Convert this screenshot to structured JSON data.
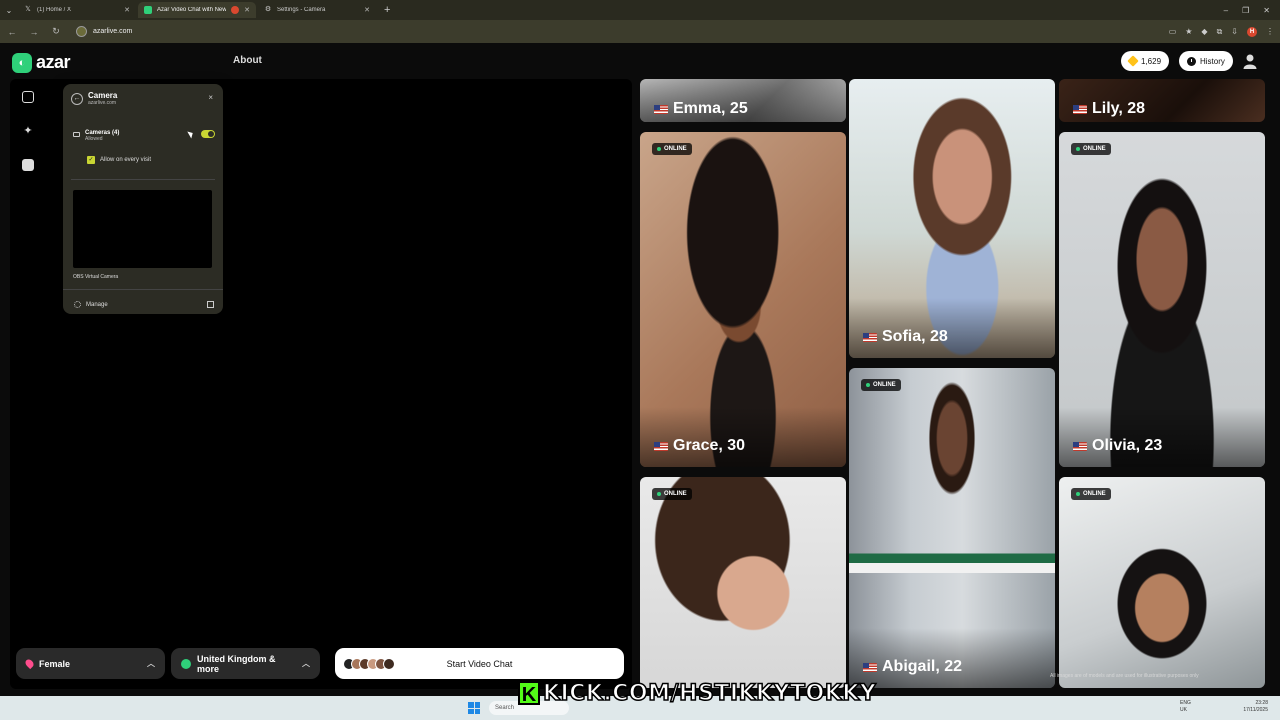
{
  "browser": {
    "tabs": [
      {
        "title": "(1) Home / X",
        "icon": "x-icon",
        "active": false
      },
      {
        "title": "Azar Video Chat with New",
        "icon": "azar-icon",
        "active": true
      },
      {
        "title": "Settings - Camera",
        "icon": "gear-icon",
        "active": false
      }
    ],
    "new_tab": "+",
    "url": "azarlive.com"
  },
  "header": {
    "logo_text": "azar",
    "nav_about": "About",
    "gems": "1,629",
    "history": "History"
  },
  "permission_popup": {
    "title": "Camera",
    "subtitle": "azarlive.com",
    "close": "×",
    "cameras_label": "Cameras (4)",
    "cameras_status": "Allowed",
    "allow_every_visit": "Allow on every visit",
    "camera_name": "OBS Virtual Camera",
    "manage": "Manage"
  },
  "controls": {
    "gender": "Female",
    "region": "United Kingdom & more",
    "start": "Start Video Chat"
  },
  "profiles": [
    {
      "name": "Emma, 25",
      "online": false
    },
    {
      "name": "Sofia, 28",
      "online": false
    },
    {
      "name": "Lily, 28",
      "online": false
    },
    {
      "name": "Grace, 30",
      "online": true,
      "badge": "ONLINE"
    },
    {
      "name": "Olivia, 23",
      "online": true,
      "badge": "ONLINE"
    },
    {
      "name": "Abigail, 22",
      "online": true,
      "badge": "ONLINE"
    },
    {
      "name": "",
      "online": true,
      "badge": "ONLINE"
    },
    {
      "name": "",
      "online": true,
      "badge": "ONLINE"
    }
  ],
  "disclaimer": "All images are of models and are used for illustrative purposes only",
  "taskbar": {
    "search": "Search",
    "lang": "ENG\nUK",
    "time": "23:28",
    "date": "17/11/2025"
  },
  "watermark": "KICK.COM/HSTIKKYTOKKY",
  "colors": {
    "accent_green": "#2fd07a",
    "toggle": "#c9d633",
    "kick_green": "#53fc18"
  }
}
